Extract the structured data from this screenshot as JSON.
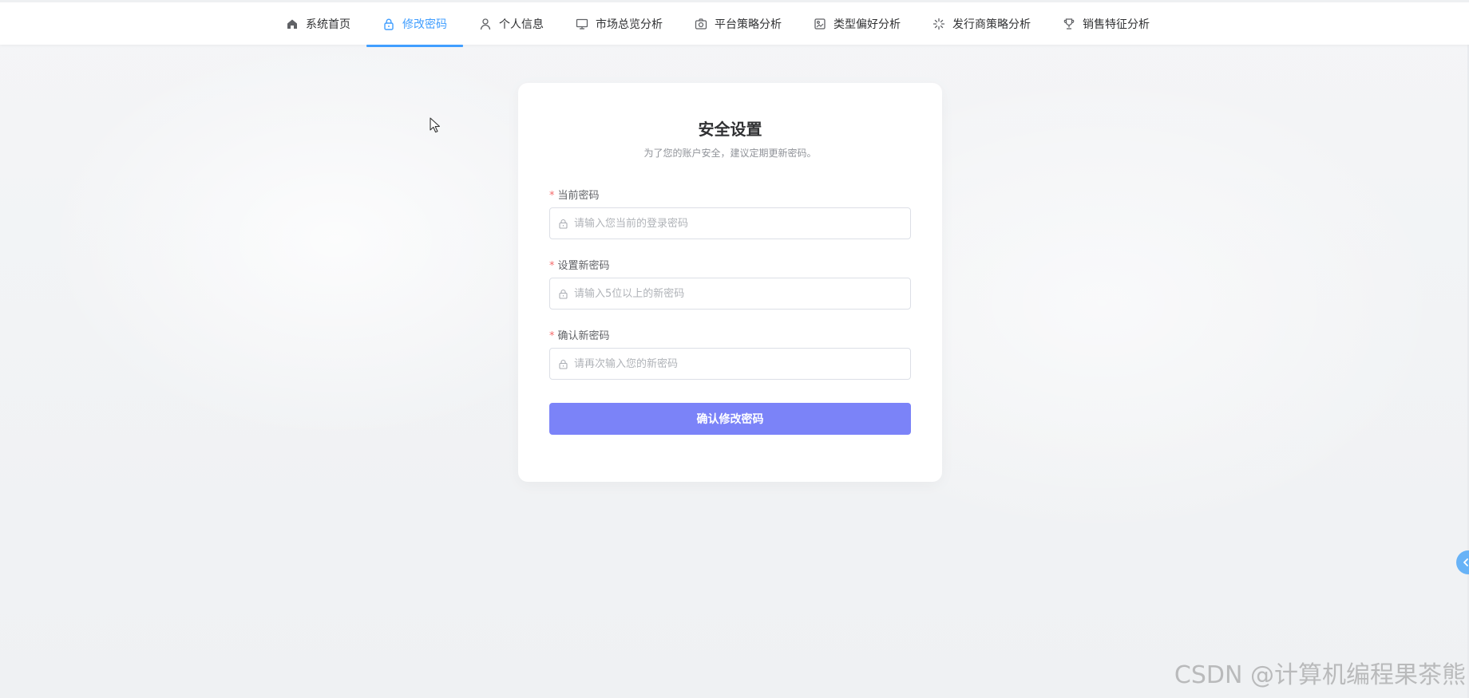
{
  "nav": {
    "items": [
      {
        "label": "系统首页",
        "icon": "home-icon"
      },
      {
        "label": "修改密码",
        "icon": "lock-icon"
      },
      {
        "label": "个人信息",
        "icon": "user-icon"
      },
      {
        "label": "市场总览分析",
        "icon": "monitor-icon"
      },
      {
        "label": "平台策略分析",
        "icon": "camera-icon"
      },
      {
        "label": "类型偏好分析",
        "icon": "picture-icon"
      },
      {
        "label": "发行商策略分析",
        "icon": "loading-icon"
      },
      {
        "label": "销售特征分析",
        "icon": "trophy-icon"
      }
    ],
    "active_index": 1,
    "active_color": "#409eff"
  },
  "form": {
    "title": "安全设置",
    "subtitle": "为了您的账户安全，建议定期更新密码。",
    "required_mark": "*",
    "fields": [
      {
        "label": "当前密码",
        "placeholder": "请输入您当前的登录密码",
        "value": ""
      },
      {
        "label": "设置新密码",
        "placeholder": "请输入5位以上的新密码",
        "value": ""
      },
      {
        "label": "确认新密码",
        "placeholder": "请再次输入您的新密码",
        "value": ""
      }
    ],
    "submit_label": "确认修改密码",
    "submit_color": "#7b83f8"
  },
  "watermark": "CSDN @计算机编程果茶熊"
}
